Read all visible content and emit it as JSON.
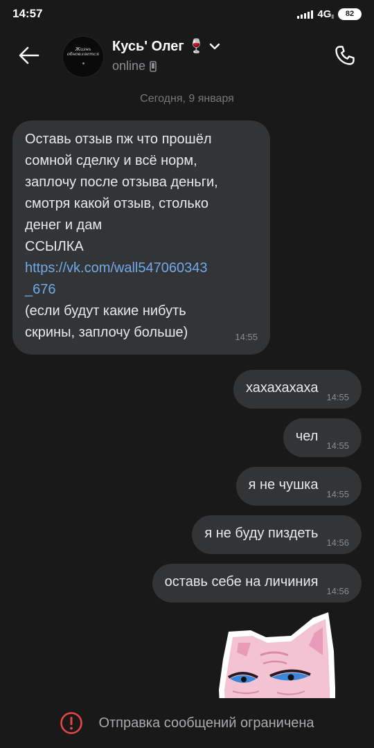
{
  "status_bar": {
    "time": "14:57",
    "network": "4G",
    "network_sub": "ll",
    "battery": "82"
  },
  "header": {
    "avatar_text_line1": "Жизнь",
    "avatar_text_line2": "обновляется",
    "name": "Кусь' Олег 🍷",
    "status": "online"
  },
  "chat": {
    "date": "Сегодня, 9 января",
    "incoming": {
      "lines": [
        "Оставь отзыв пж что прошёл",
        "сомной сделку и всё норм,",
        "заплочу после отзыва деньги,",
        "смотря какой отзыв, столько",
        "денег и дам",
        "ССЫЛКА"
      ],
      "link_line1": "https://vk.com/wall547060343",
      "link_line2": "_676",
      "tail_lines": [
        "(если будут какие нибуть",
        "скрины, заплочу больше)"
      ],
      "time": "14:55"
    },
    "outgoing": [
      {
        "text": "хахахахаха",
        "time": "14:55"
      },
      {
        "text": "чел",
        "time": "14:55"
      },
      {
        "text": "я не чушка",
        "time": "14:55"
      },
      {
        "text": "я не буду пиздеть",
        "time": "14:56"
      },
      {
        "text": "оставь себе на личиния",
        "time": "14:56"
      }
    ]
  },
  "bottom": {
    "text": "Отправка сообщений ограничена"
  },
  "colors": {
    "background": "#19191a",
    "bubble": "#333436",
    "link": "#71aaeb",
    "warning": "#e64646"
  }
}
